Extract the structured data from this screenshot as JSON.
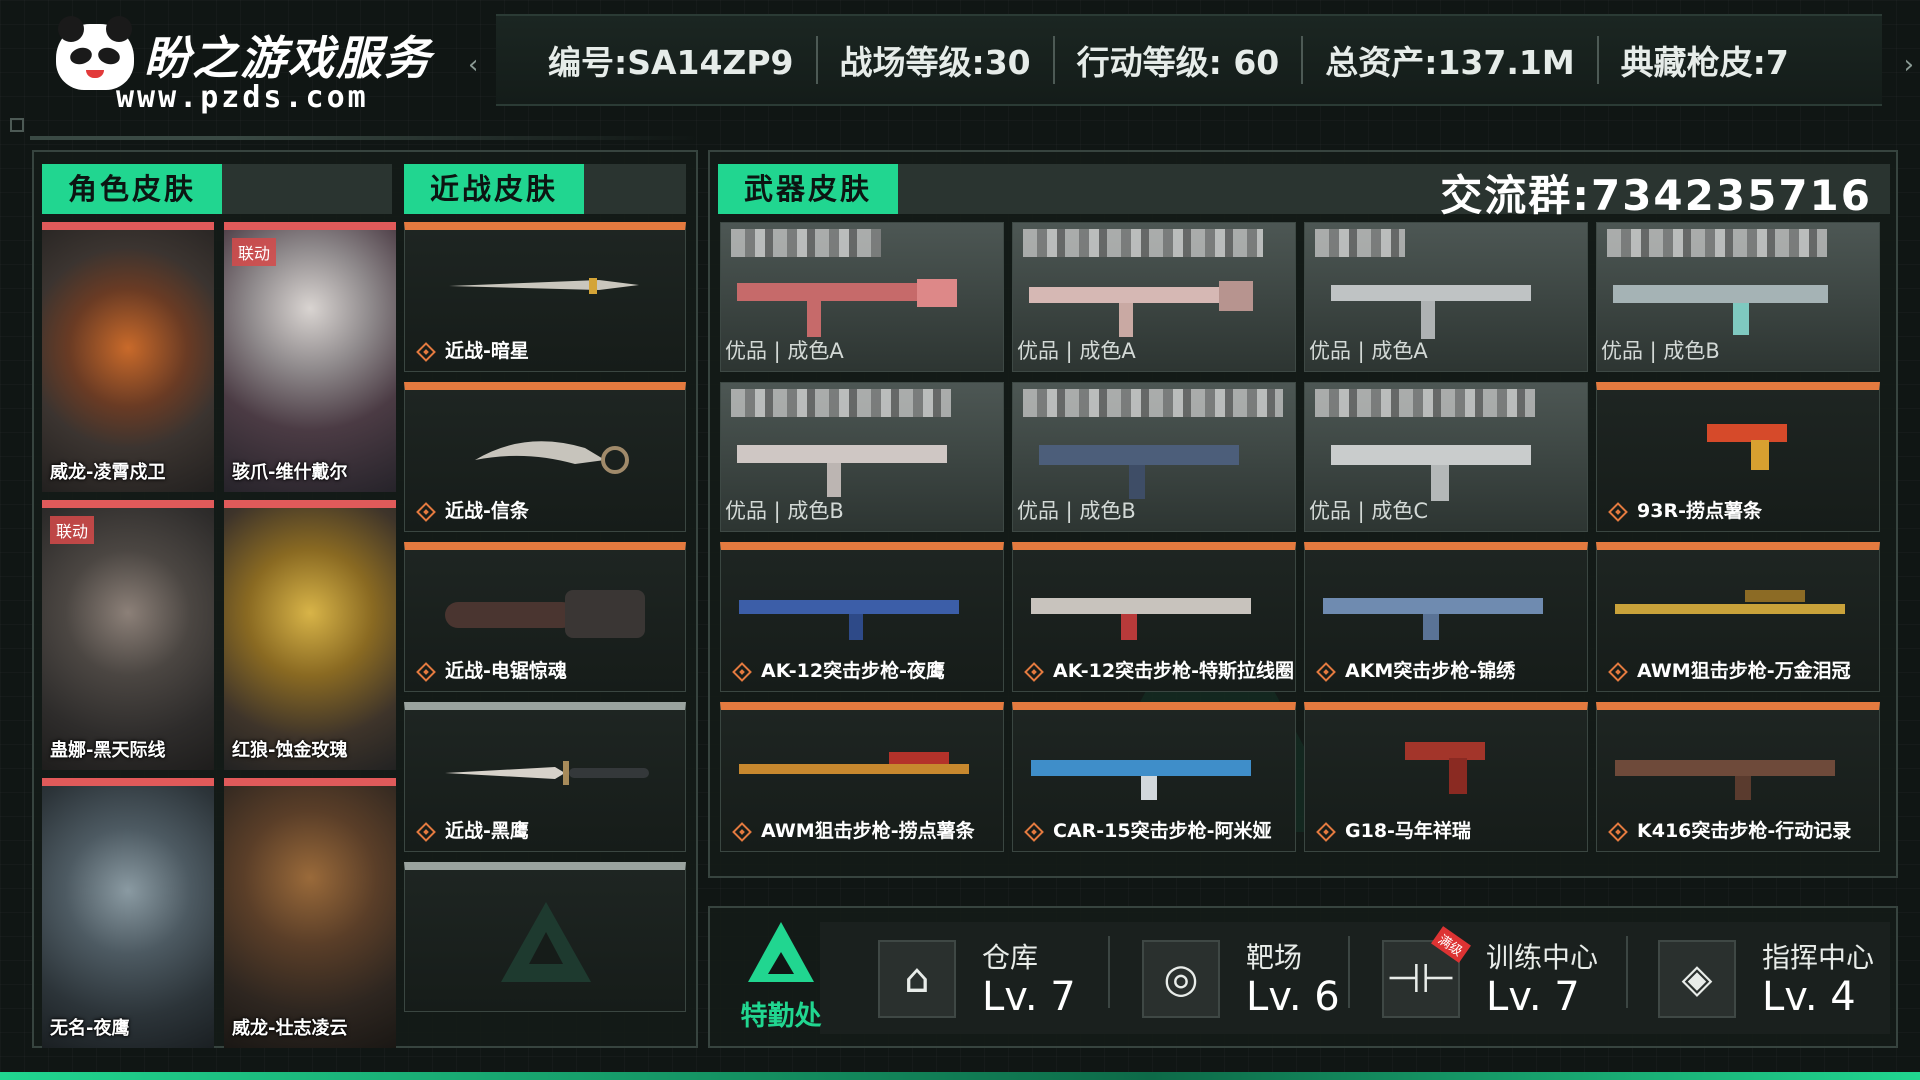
{
  "header": {
    "logo_title": "盼之游戏服务",
    "logo_url": "www.pzds.com",
    "stats": [
      "编号:SA14ZP9",
      "战场等级:30",
      "行动等级: 60",
      "总资产:137.1M",
      "典藏枪皮:7"
    ]
  },
  "sections": {
    "character": "角色皮肤",
    "melee": "近战皮肤",
    "weapon": "武器皮肤",
    "group": "交流群:734235716"
  },
  "characters": [
    {
      "name": "威龙-凌霄戍卫",
      "badge": ""
    },
    {
      "name": "骇爪-维什戴尔",
      "badge": "联动"
    },
    {
      "name": "蛊娜-黑天际线",
      "badge": "联动"
    },
    {
      "name": "红狼-蚀金玫瑰",
      "badge": ""
    },
    {
      "name": "无名-夜鹰",
      "badge": ""
    },
    {
      "name": "威龙-壮志凌云",
      "badge": ""
    }
  ],
  "melee": [
    {
      "name": "近战-暗星"
    },
    {
      "name": "近战-信条"
    },
    {
      "name": "近战-电锯惊魂"
    },
    {
      "name": "近战-黑鹰"
    }
  ],
  "graded_guns": [
    {
      "grade": "优品 | 成色A"
    },
    {
      "grade": "优品 | 成色A"
    },
    {
      "grade": "优品 | 成色A"
    },
    {
      "grade": "优品 | 成色B"
    },
    {
      "grade": "优品 | 成色B"
    },
    {
      "grade": "优品 | 成色B"
    },
    {
      "grade": "优品 | 成色C"
    }
  ],
  "weapons": [
    {
      "name": "93R-捞点薯条"
    },
    {
      "name": "AK-12突击步枪-夜鹰"
    },
    {
      "name": "AK-12突击步枪-特斯拉线圈"
    },
    {
      "name": "AKM突击步枪-锦绣"
    },
    {
      "name": "AWM狙击步枪-万金泪冠"
    },
    {
      "name": "AWM狙击步枪-捞点薯条"
    },
    {
      "name": "CAR-15突击步枪-阿米娅"
    },
    {
      "name": "G18-马年祥瑞"
    },
    {
      "name": "K416突击步枪-行动记录"
    }
  ],
  "facilities": {
    "brand": "特勤处",
    "items": [
      {
        "name": "仓库",
        "level": "Lv. 7",
        "icon": "warehouse-icon"
      },
      {
        "name": "靶场",
        "level": "Lv. 6",
        "icon": "target-icon"
      },
      {
        "name": "训练中心",
        "level": "Lv. 7",
        "icon": "dumbbell-icon",
        "ribbon": "满级"
      },
      {
        "name": "指挥中心",
        "level": "Lv. 4",
        "icon": "command-icon"
      }
    ]
  },
  "colors": {
    "accent": "#21d690",
    "orange_rarity": "#e47a3f",
    "red_rarity": "#e05a5a"
  }
}
